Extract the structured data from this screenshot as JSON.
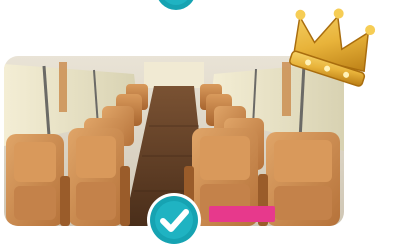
{
  "image": {
    "subject": "bus-interior-seats",
    "caption_sign": "",
    "icons": {
      "top": "check-badge-icon",
      "bottom": "check-badge-icon",
      "decoration": "crown-icon"
    },
    "colors": {
      "badge_teal": "#16a3b2",
      "crown_gold": "#e8b33a",
      "seat_tan": "#c98a4a",
      "floor_wood": "#5a3a22",
      "sign_pink": "#e7398c"
    }
  }
}
